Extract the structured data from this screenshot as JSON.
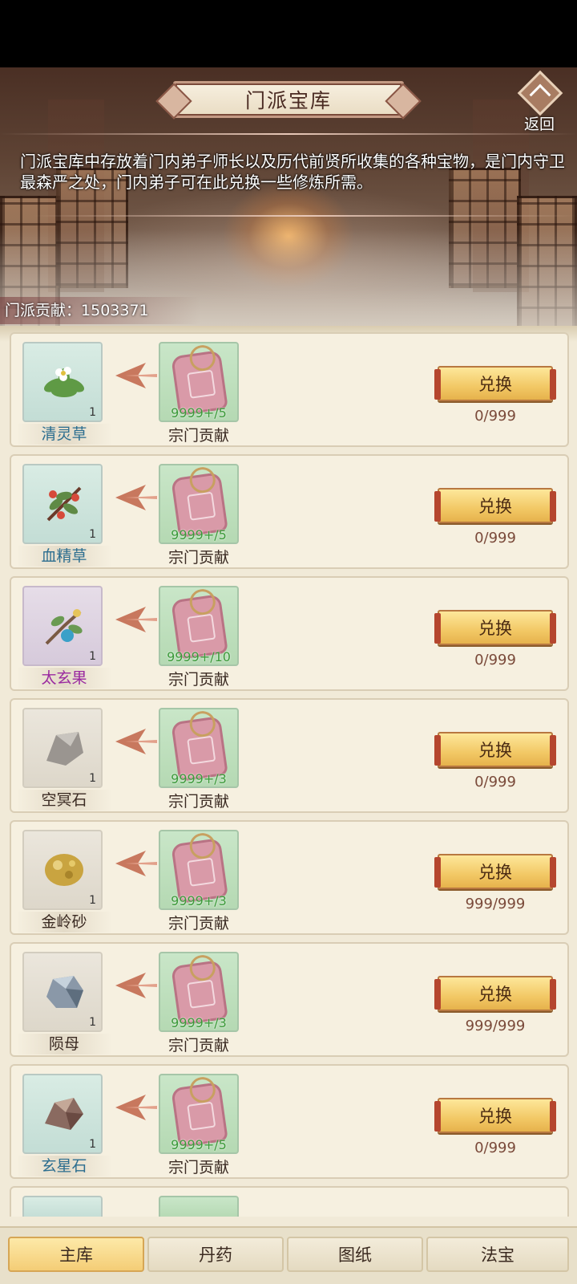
{
  "header": {
    "title": "门派宝库",
    "back_label": "返回",
    "description": "门派宝库中存放着门内弟子师长以及历代前贤所收集的各种宝物，是门内守卫最森严之处，门内弟子可在此兑换一些修炼所需。",
    "contribution_label": "门派贡献：",
    "contribution_value": "1503371"
  },
  "colors": {
    "item_name_teal": "#2b6d8f",
    "item_name_purple": "#9a2aa0",
    "item_name_default": "#3a2a22",
    "cost_green": "#3c9a3a",
    "button_gold": "#f2c865"
  },
  "items": [
    {
      "name": "清灵草",
      "icon": "white-flower-herb-icon",
      "count": "1",
      "cost": "9999+/5",
      "currency": "宗门贡献",
      "button": "兑换",
      "stock": "0/999"
    },
    {
      "name": "血精草",
      "icon": "red-berry-herb-icon",
      "count": "1",
      "cost": "9999+/5",
      "currency": "宗门贡献",
      "button": "兑换",
      "stock": "0/999"
    },
    {
      "name": "太玄果",
      "icon": "blue-fruit-branch-icon",
      "count": "1",
      "cost": "9999+/10",
      "currency": "宗门贡献",
      "button": "兑换",
      "stock": "0/999"
    },
    {
      "name": "空冥石",
      "icon": "grey-stone-icon",
      "count": "1",
      "cost": "9999+/3",
      "currency": "宗门贡献",
      "button": "兑换",
      "stock": "0/999"
    },
    {
      "name": "金岭砂",
      "icon": "gold-ore-icon",
      "count": "1",
      "cost": "9999+/3",
      "currency": "宗门贡献",
      "button": "兑换",
      "stock": "999/999"
    },
    {
      "name": "陨母",
      "icon": "meteorite-ore-icon",
      "count": "1",
      "cost": "9999+/3",
      "currency": "宗门贡献",
      "button": "兑换",
      "stock": "999/999"
    },
    {
      "name": "玄星石",
      "icon": "star-stone-icon",
      "count": "1",
      "cost": "9999+/5",
      "currency": "宗门贡献",
      "button": "兑换",
      "stock": "0/999"
    }
  ],
  "tabs": [
    {
      "label": "主库",
      "active": true
    },
    {
      "label": "丹药",
      "active": false
    },
    {
      "label": "图纸",
      "active": false
    },
    {
      "label": "法宝",
      "active": false
    }
  ]
}
